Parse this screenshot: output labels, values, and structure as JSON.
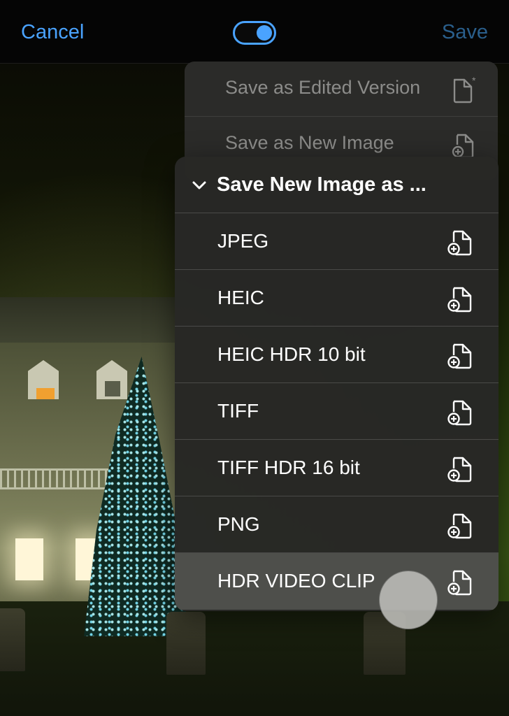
{
  "nav": {
    "cancel": "Cancel",
    "save": "Save",
    "toggle_on": true,
    "accent_color": "#4aa3ff"
  },
  "save_menu": {
    "items": [
      {
        "label": "Save as Edited Version",
        "icon": "document-asterisk-icon"
      },
      {
        "label": "Save as New Image",
        "icon": "document-plus-icon"
      }
    ]
  },
  "format_menu": {
    "title": "Save New Image as ...",
    "header_icon": "chevron-down-icon",
    "options": [
      {
        "label": "JPEG",
        "icon": "document-plus-icon"
      },
      {
        "label": "HEIC",
        "icon": "document-plus-icon"
      },
      {
        "label": "HEIC HDR 10 bit",
        "icon": "document-plus-icon"
      },
      {
        "label": "TIFF",
        "icon": "document-plus-icon"
      },
      {
        "label": "TIFF HDR 16 bit",
        "icon": "document-plus-icon"
      },
      {
        "label": "PNG",
        "icon": "document-plus-icon"
      },
      {
        "label": "HDR VIDEO CLIP",
        "icon": "document-plus-icon",
        "highlighted": true
      }
    ]
  }
}
